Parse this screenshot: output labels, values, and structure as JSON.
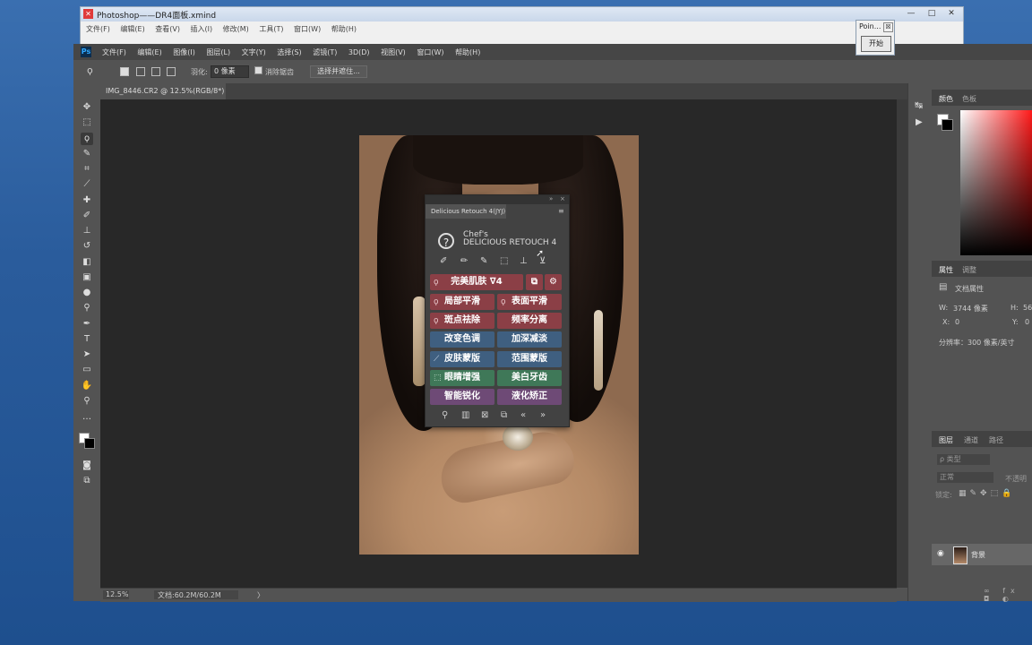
{
  "xmind": {
    "title": "Photoshop——DR4面板.xmind",
    "controls": [
      "—",
      "□",
      "✕"
    ],
    "menu": [
      "文件(F)",
      "编辑(E)",
      "查看(V)",
      "插入(I)",
      "修改(M)",
      "工具(T)",
      "窗口(W)",
      "帮助(H)"
    ]
  },
  "popup": {
    "title": "Poin...",
    "close": "☒",
    "button": "开始"
  },
  "photoshop": {
    "logo": "Ps",
    "menu": [
      "文件(F)",
      "编辑(E)",
      "图像(I)",
      "图层(L)",
      "文字(Y)",
      "选择(S)",
      "滤镜(T)",
      "3D(D)",
      "视图(V)",
      "窗口(W)",
      "帮助(H)"
    ],
    "options": {
      "feather_label": "羽化:",
      "feather_value": "0 像素",
      "antialias_label": "消除锯齿",
      "select_mask_button": "选择并遮住..."
    },
    "document_tab": {
      "name": "IMG_8446.CR2 @ 12.5%(RGB/8*)",
      "close": "×"
    },
    "status": {
      "zoom": "12.5%",
      "doc": "文档:60.2M/60.2M",
      "arrow": "〉"
    },
    "color_panel": {
      "tab1": "颜色",
      "tab2": "色板"
    },
    "properties_panel": {
      "tab1": "属性",
      "tab2": "调整",
      "doc_props": "文档属性",
      "w_label": "W:",
      "w_value": "3744 像素",
      "h_label": "H:",
      "h_value": "56",
      "x_label": "X:",
      "x_value": "0",
      "y_label": "Y:",
      "y_value": "0",
      "resolution": "分辨率：300 像素/英寸"
    },
    "layers_panel": {
      "tab1": "图层",
      "tab2": "通道",
      "tab3": "路径",
      "kind_placeholder": "ρ 类型",
      "blend_mode": "正常",
      "opacity_label": "不透明",
      "lock_label": "锁定:",
      "layer_name": "背景"
    }
  },
  "delicious_retouch": {
    "tab": "Delicious Retouch 4(JYJ)",
    "brand_line1": "Chef's",
    "brand_line2": "DELICIOUS RETOUCH 4",
    "help": "?",
    "buttons": {
      "perfect_skin": "完美肌肤",
      "perfect_skin_suffix": "∇4",
      "local_smooth": "局部平滑",
      "surface_smooth": "表面平滑",
      "spot_removal": "斑点祛除",
      "freq_sep": "频率分离",
      "change_tone": "改变色调",
      "dodge_burn": "加深减淡",
      "skin_mask": "皮肤蒙版",
      "range_mask": "范围蒙版",
      "eye_enhance": "眼睛增强",
      "teeth_whiten": "美白牙齿",
      "smart_sharpen": "智能锐化",
      "liquify": "液化矫正"
    },
    "colors": {
      "red": "#8b3f46",
      "blue": "#3f5f80",
      "green": "#3f7858",
      "purple": "#6e4a76"
    }
  }
}
